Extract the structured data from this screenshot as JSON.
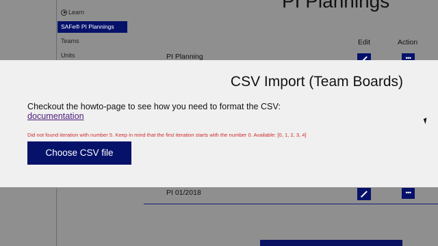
{
  "sidebar": {
    "items": [
      {
        "label": "Learn"
      },
      {
        "label": "SAFe® PI Plannings"
      },
      {
        "label": "Teams"
      },
      {
        "label": "Units"
      }
    ]
  },
  "main": {
    "title": "PI Plannings",
    "columns": {
      "edit": "Edit",
      "action": "Action"
    },
    "rows": [
      {
        "name": "PI Planning",
        "action": "•••"
      },
      {
        "name": "PI 01/2018",
        "action": "•••"
      }
    ]
  },
  "modal": {
    "title": "CSV Import (Team Boards)",
    "description": "Checkout the howto-page to see how you need to format the CSV: ",
    "link_label": "documentation",
    "error": "Did not found iteration with number 5. Keep in mind that the first iteration starts with the number 0. Available: [0, 1, 2, 3, 4]",
    "button_label": "Choose CSV file"
  },
  "colors": {
    "accent": "#06126a",
    "error": "#d02b2b",
    "link": "#4a1a78",
    "overlay": "#8f8f8f",
    "modal_bg": "#f0f0f0"
  }
}
